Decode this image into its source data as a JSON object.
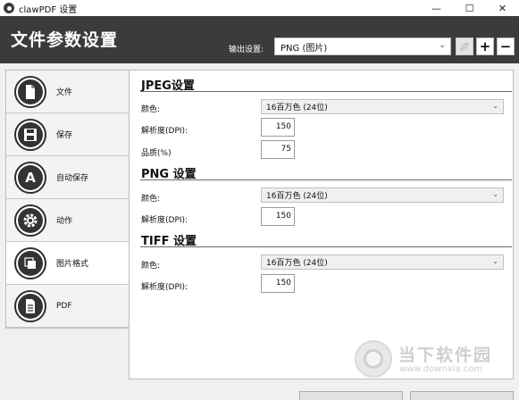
{
  "window": {
    "title": "clawPDF 设置",
    "minimize": "—",
    "maximize": "☐",
    "close": "✕"
  },
  "header": {
    "title": "文件参数设置",
    "profile_label": "输出设置:",
    "profile_value": "PNG (图片)",
    "add_label": "+",
    "remove_label": "−"
  },
  "sidebar": {
    "items": [
      {
        "label": "文件",
        "icon": "document-icon"
      },
      {
        "label": "保存",
        "icon": "floppy-disk-icon"
      },
      {
        "label": "自动保存",
        "icon": "auto-save-a-icon"
      },
      {
        "label": "动作",
        "icon": "gear-icon"
      },
      {
        "label": "图片格式",
        "icon": "image-stack-icon"
      },
      {
        "label": "PDF",
        "icon": "pdf-document-icon"
      }
    ],
    "active_index": 4,
    "auto_save_letter": "A"
  },
  "main": {
    "jpeg": {
      "title": "JPEG设置",
      "color_label": "颜色:",
      "color_value": "16百万色 (24位)",
      "dpi_label": "解析度(DPI):",
      "dpi_value": "150",
      "quality_label": "品质(%)",
      "quality_value": "75"
    },
    "png": {
      "title": "PNG 设置",
      "color_label": "颜色:",
      "color_value": "16百万色 (24位)",
      "dpi_label": "解析度(DPI):",
      "dpi_value": "150"
    },
    "tiff": {
      "title": "TIFF 设置",
      "color_label": "颜色:",
      "color_value": "16百万色 (24位)",
      "dpi_label": "解析度(DPI):",
      "dpi_value": "150"
    }
  },
  "watermark": {
    "name": "当下软件园",
    "url": "www.downxia.com"
  },
  "colors": {
    "header_bg": "#3b3b3b",
    "title_bar_bg": "#ffffff",
    "panel_bg": "#ffffff",
    "window_bg": "#f0f0f0"
  }
}
